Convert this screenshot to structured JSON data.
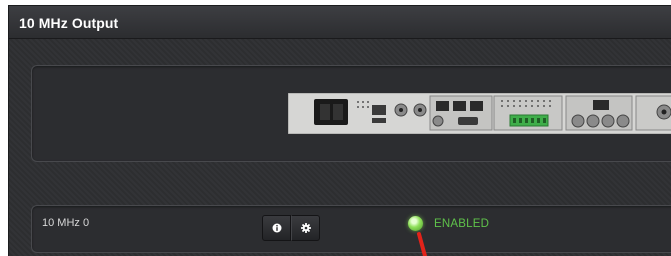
{
  "panel": {
    "title": "10 MHz Output"
  },
  "device_image": {
    "icon": "rear-panel-device-image"
  },
  "outputs": [
    {
      "label": "10 MHz 0",
      "info_icon": "info-icon",
      "settings_icon": "gear-icon",
      "status": "ENABLED",
      "status_color": "#5fc24a"
    }
  ],
  "annotation": {
    "arrow_color": "#e2231a"
  }
}
